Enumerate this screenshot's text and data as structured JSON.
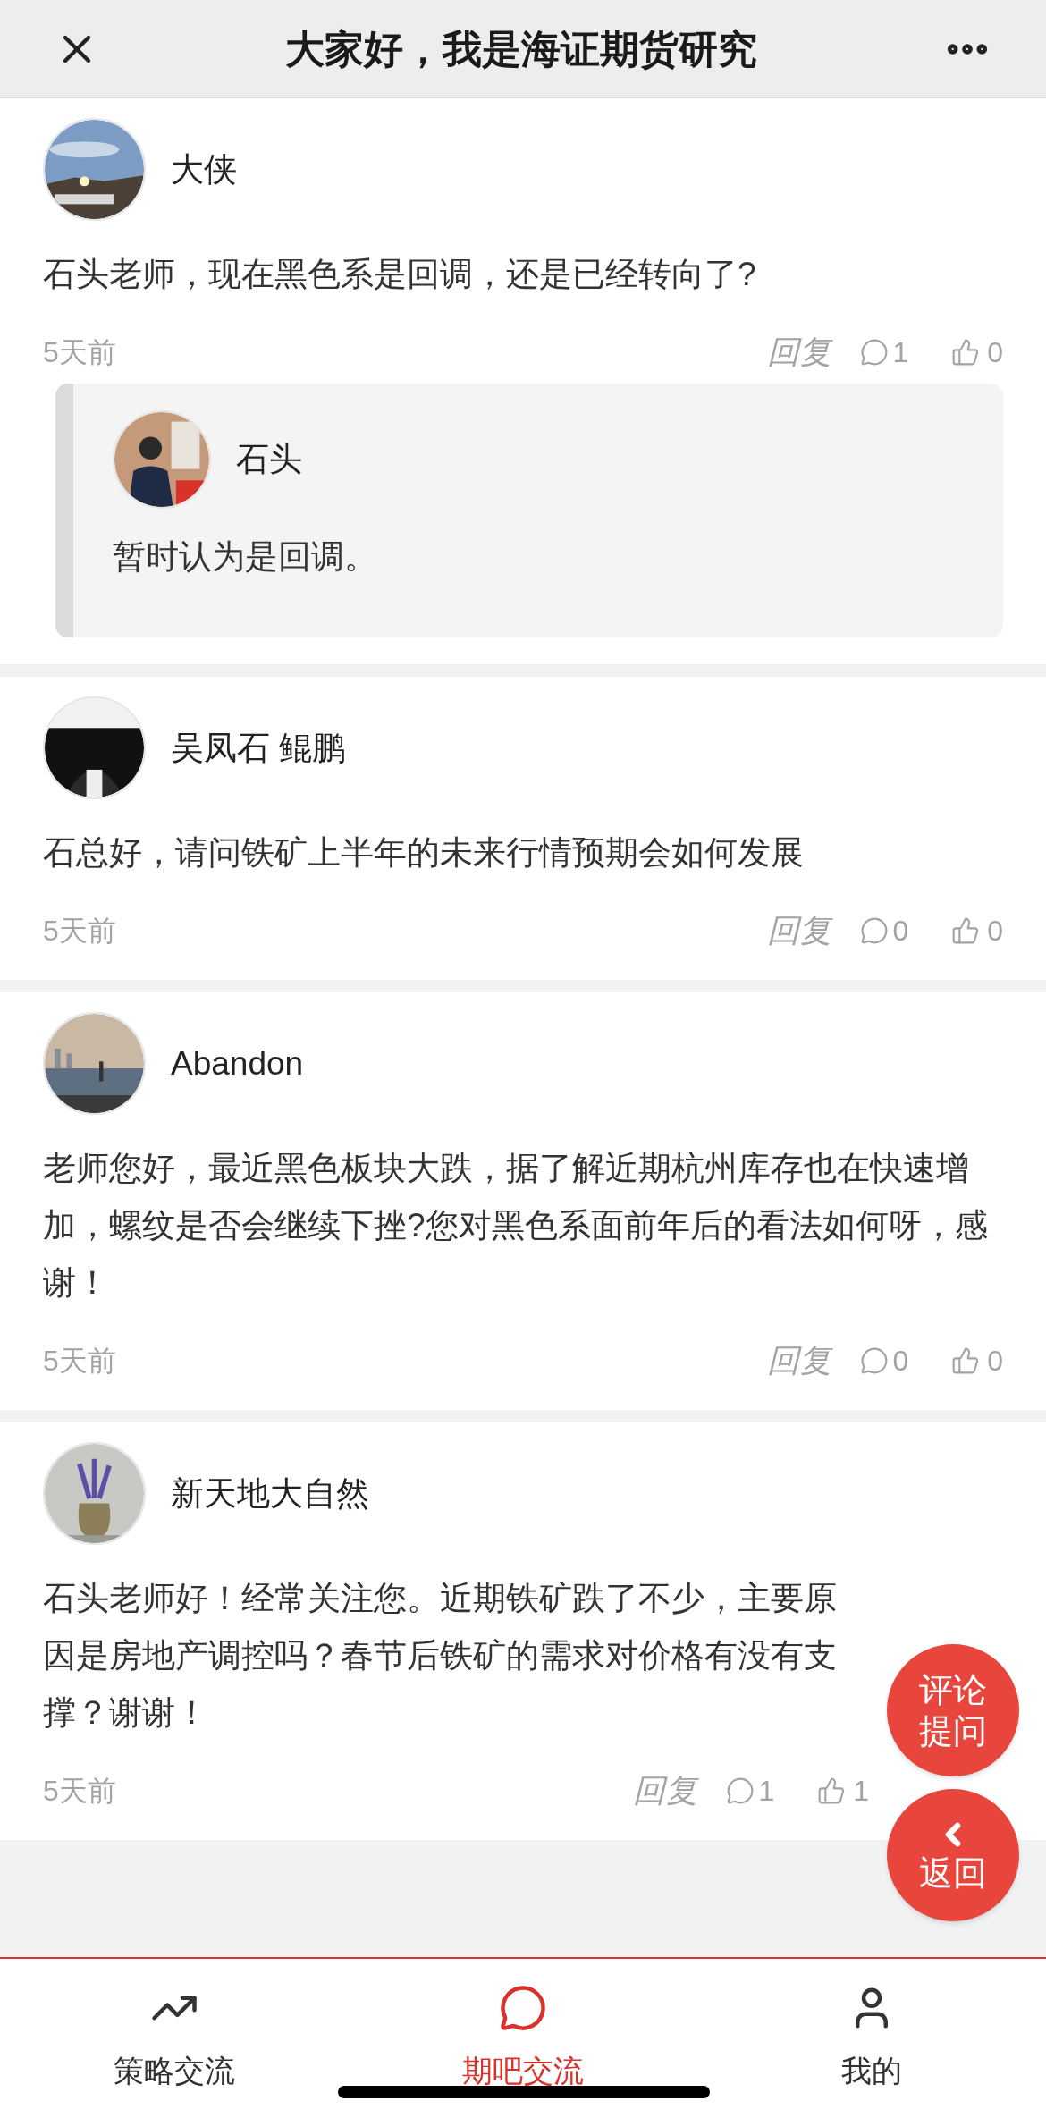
{
  "header": {
    "title": "大家好，我是海证期货研究"
  },
  "posts": [
    {
      "author": "大侠",
      "text": "石头老师，现在黑色系是回调，还是已经转向了?",
      "time": "5天前",
      "reply_label": "回复",
      "comments": "1",
      "likes": "0",
      "avatar": {
        "kind": "picture"
      },
      "replies": [
        {
          "author": "石头",
          "text": "暂时认为是回调。",
          "avatar": {
            "kind": "picture"
          }
        }
      ]
    },
    {
      "author": "吴凤石 鲲鹏",
      "text": "石总好，请问铁矿上半年的未来行情预期会如何发展",
      "time": "5天前",
      "reply_label": "回复",
      "comments": "0",
      "likes": "0",
      "avatar": {
        "kind": "picture"
      }
    },
    {
      "author": "Abandon",
      "text": "老师您好，最近黑色板块大跌，据了解近期杭州库存也在快速增加，螺纹是否会继续下挫?您对黑色系面前年后的看法如何呀，感谢！",
      "time": "5天前",
      "reply_label": "回复",
      "comments": "0",
      "likes": "0",
      "avatar": {
        "kind": "picture"
      }
    },
    {
      "author": "新天地大自然",
      "text": "石头老师好！经常关注您。近期铁矿跌了不少，主要原因是房地产调控吗？春节后铁矿的需求对价格有没有支撑？谢谢！",
      "time": "5天前",
      "reply_label": "回复",
      "comments": "1",
      "likes": "1",
      "avatar": {
        "kind": "picture"
      }
    }
  ],
  "floating_buttons": [
    {
      "label": "评论提问"
    },
    {
      "label": "返回"
    }
  ],
  "tabs": [
    {
      "label": "策略交流",
      "selected": false
    },
    {
      "label": "期吧交流",
      "selected": true
    },
    {
      "label": "我的",
      "selected": false
    }
  ]
}
